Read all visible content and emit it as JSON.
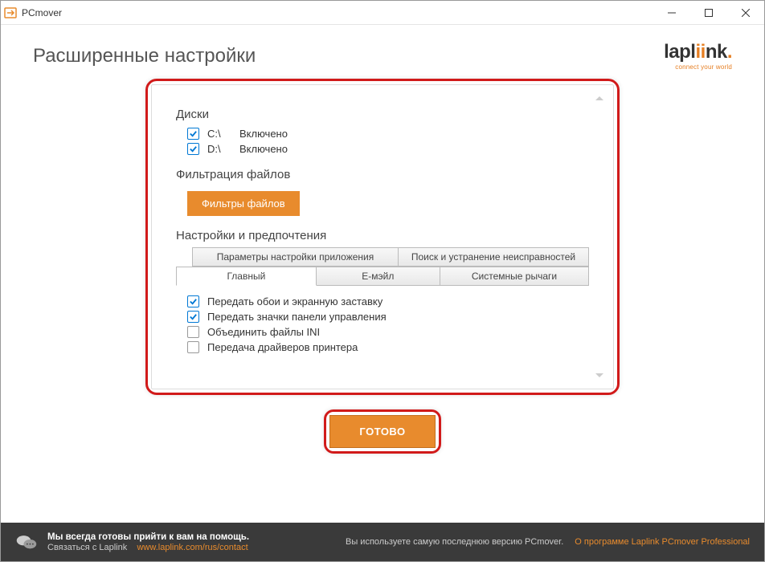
{
  "window": {
    "title": "PCmover"
  },
  "header": {
    "page_title": "Расширенные настройки",
    "logo_main_pre": "lapl",
    "logo_main_post": "nk",
    "logo_sub": "connect your world"
  },
  "panel": {
    "drives_title": "Диски",
    "drives": [
      {
        "letter": "C:\\",
        "status": "Включено",
        "checked": true
      },
      {
        "letter": "D:\\",
        "status": "Включено",
        "checked": true
      }
    ],
    "filter_title": "Фильтрация файлов",
    "filter_button": "Фильтры файлов",
    "prefs_title": "Настройки и предпочтения",
    "tabs_row1": [
      "Параметры настройки приложения",
      "Поиск и устранение неисправностей"
    ],
    "tabs_row2": [
      "Главный",
      "Е-мэйл",
      "Системные рычаги"
    ],
    "active_tab": 0,
    "prefs": [
      {
        "label": "Передать обои и экранную заставку",
        "checked": true
      },
      {
        "label": "Передать значки панели управления",
        "checked": true
      },
      {
        "label": "Объединить файлы INI",
        "checked": false
      },
      {
        "label": "Передача драйверов принтера",
        "checked": false
      }
    ]
  },
  "done_button": "ГОТОВО",
  "footer": {
    "help_title": "Мы всегда готовы прийти к вам на помощь.",
    "contact_label": "Связаться с Laplink",
    "contact_url": "www.laplink.com/rus/contact",
    "version_text": "Вы используете самую последнюю версию PCmover.",
    "about_link": "О программе Laplink PCmover Professional"
  }
}
